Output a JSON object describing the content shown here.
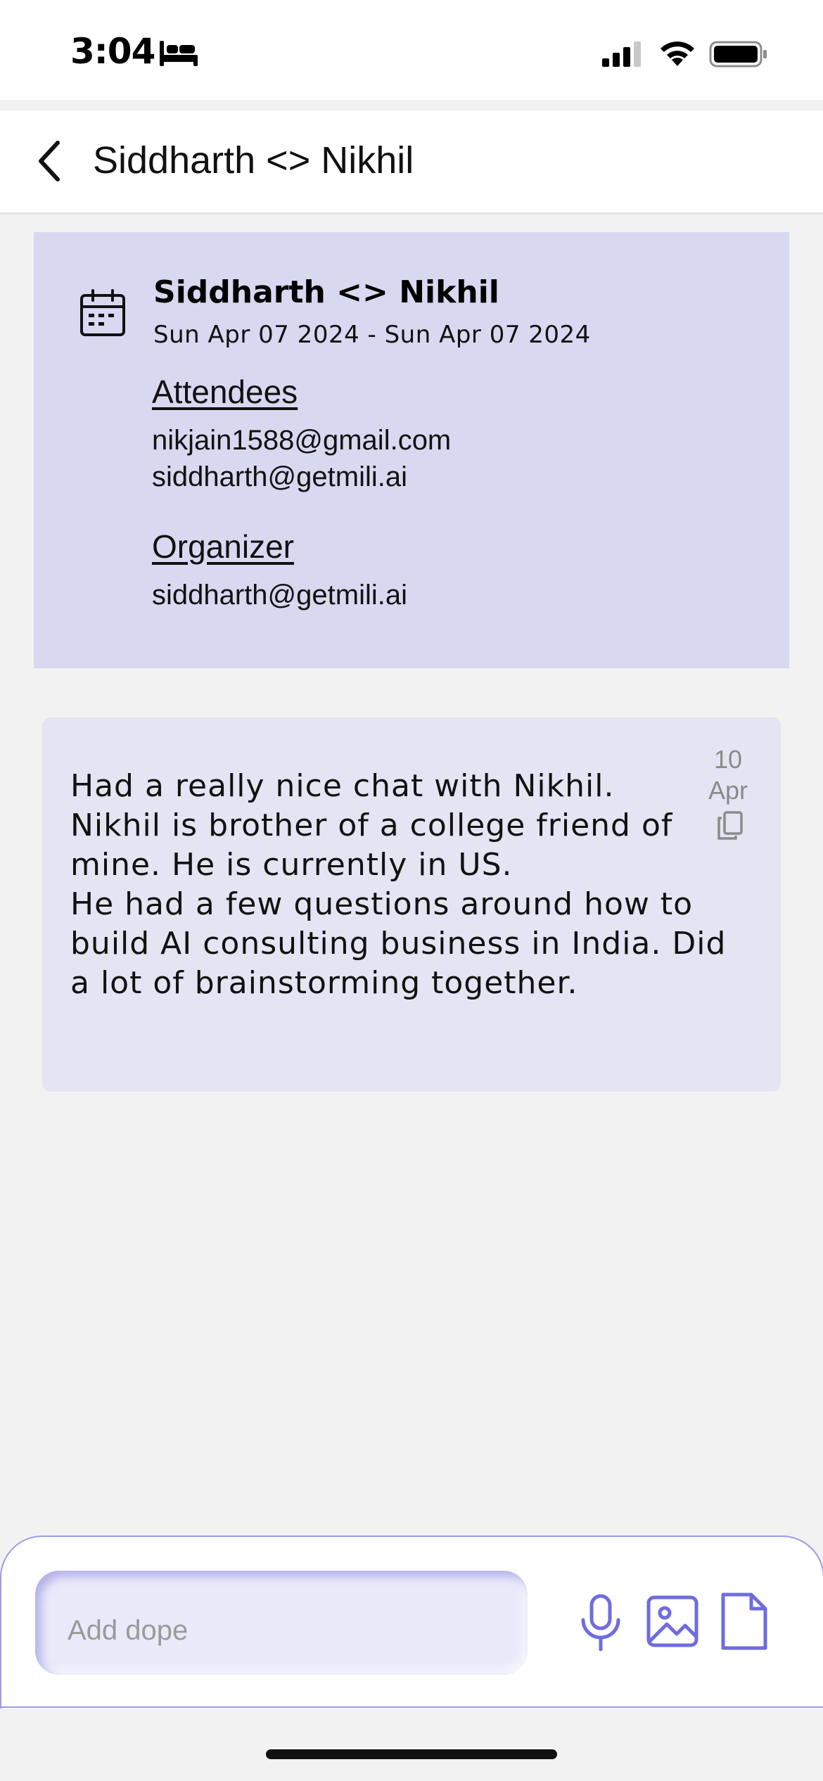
{
  "status_bar": {
    "time": "3:04",
    "icons": [
      "bed-icon",
      "cellular-signal-icon",
      "wifi-icon",
      "battery-icon"
    ]
  },
  "header": {
    "title": "Siddharth <> Nikhil",
    "back_icon": "chevron-left-icon"
  },
  "event": {
    "icon": "calendar-icon",
    "title": "Siddharth <> Nikhil",
    "dates": "Sun Apr 07 2024 - Sun Apr 07 2024",
    "attendees_label": "Attendees",
    "attendees": [
      "nikjain1588@gmail.com",
      "siddharth@getmili.ai"
    ],
    "organizer_label": "Organizer",
    "organizer": "siddharth@getmili.ai"
  },
  "note": {
    "text": "Had a really nice chat with Nikhil.\nNikhil is brother of a college friend of mine. He is currently in US.\nHe had a few questions around how to build AI consulting business in India. Did a lot of brainstorming together.",
    "date_day": "10",
    "date_month": "Apr",
    "copy_icon": "copy-icon"
  },
  "composer": {
    "placeholder": "Add dope",
    "value": "",
    "icons": [
      "microphone-icon",
      "image-icon",
      "file-icon"
    ]
  },
  "colors": {
    "accent": "#6f6ce0",
    "event_card_bg": "#d9d8f1",
    "note_card_bg": "#e5e4f3",
    "page_bg": "#f2f2f2"
  }
}
